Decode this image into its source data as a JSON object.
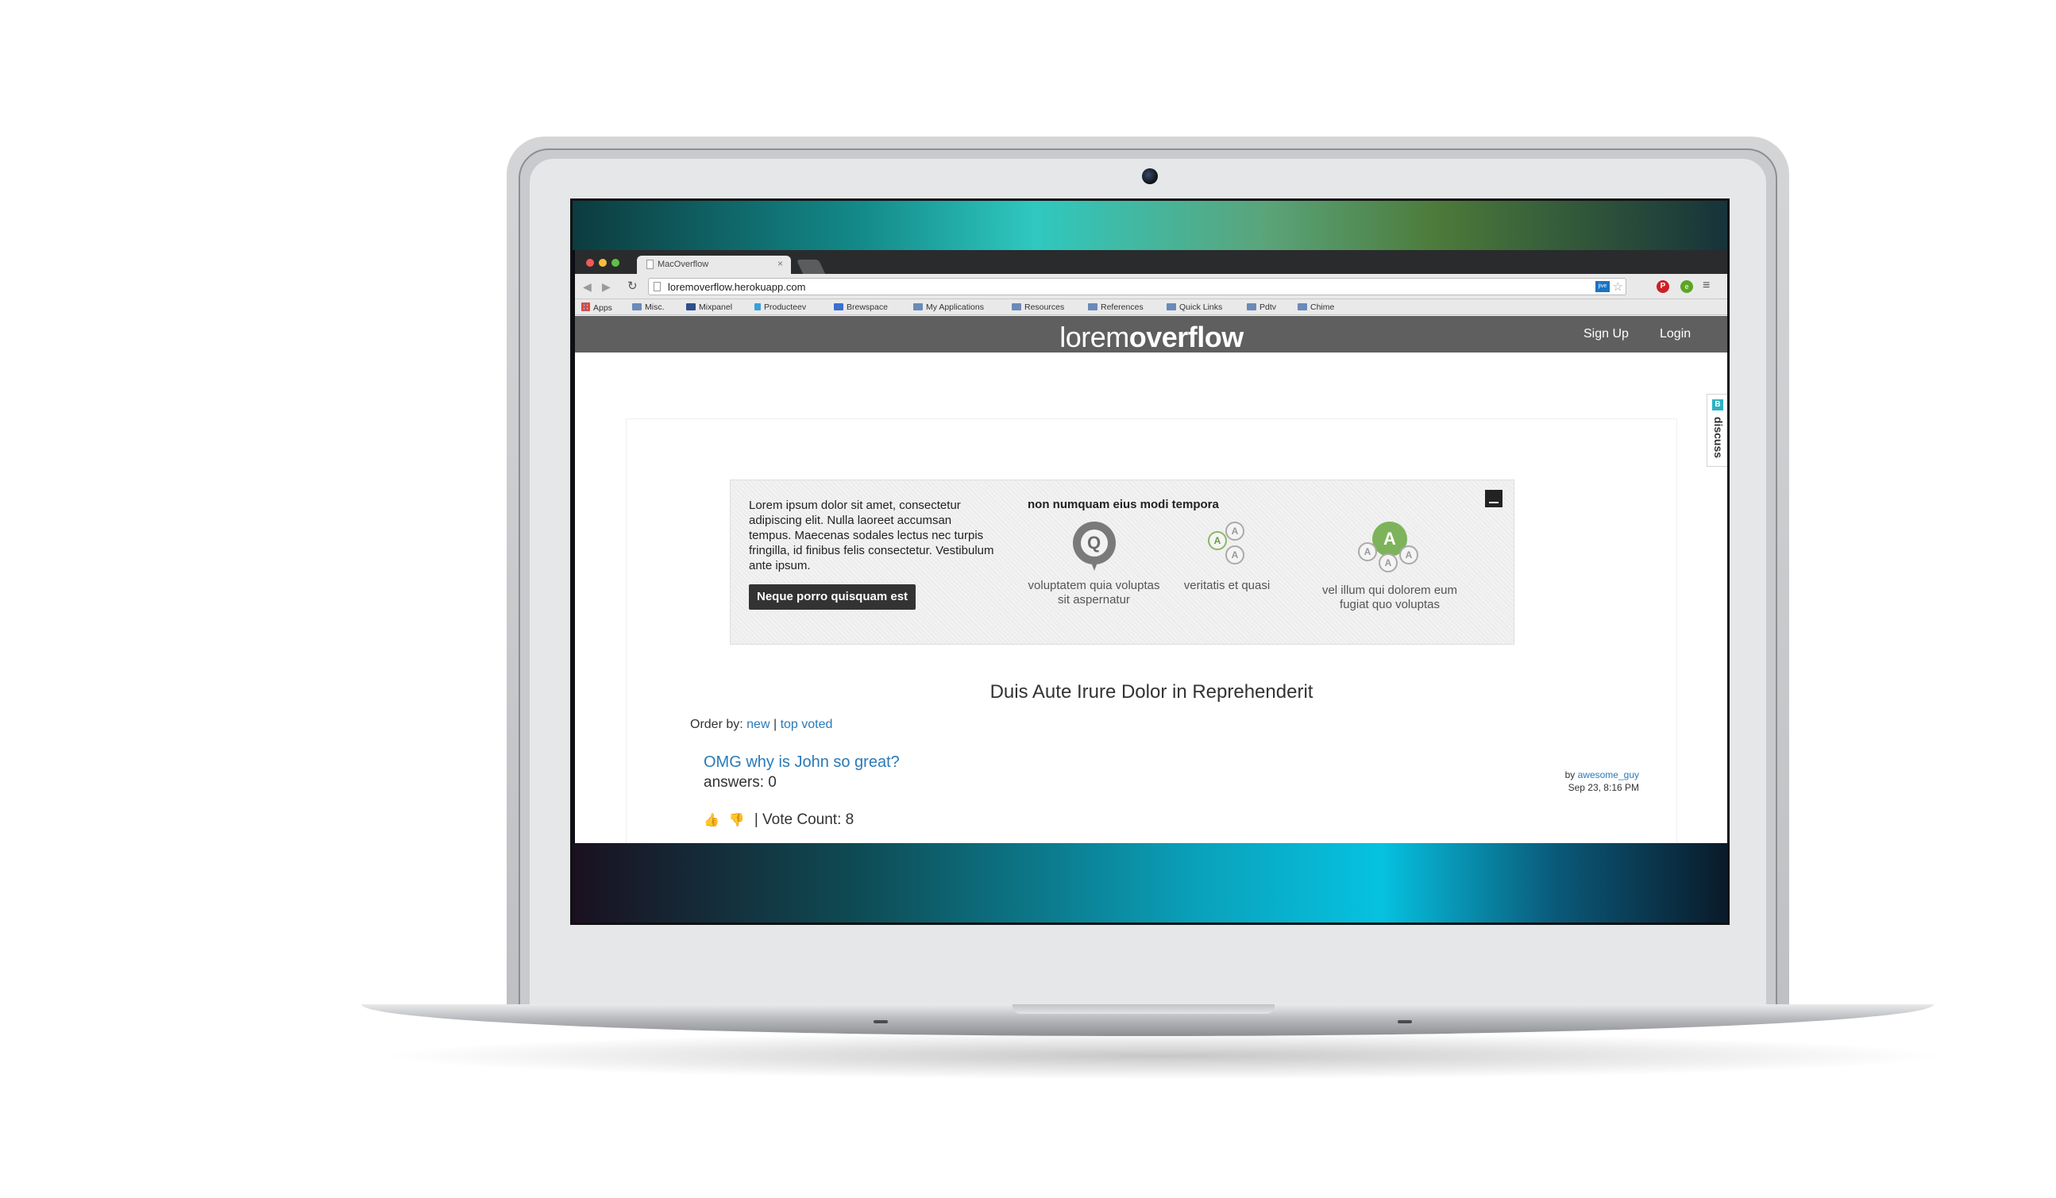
{
  "browser": {
    "tab_title": "MacOverflow",
    "url": "loremoverflow.herokuapp.com",
    "extensions": {
      "jive": "jive",
      "pinterest": "P",
      "evernote": "e"
    },
    "bookmarks": [
      "Apps",
      "Misc.",
      "Mixpanel",
      "Producteev",
      "Brewspace",
      "My Applications",
      "Resources",
      "References",
      "Quick Links",
      "Pdtv",
      "Chime"
    ]
  },
  "header": {
    "logo_light": "lorem",
    "logo_bold": "overflow",
    "signup": "Sign Up",
    "login": "Login"
  },
  "discuss": {
    "badge": "B",
    "label": "discuss"
  },
  "intro": {
    "text": "Lorem ipsum dolor sit amet, consectetur adipiscing elit. Nulla laoreet accumsan tempus. Maecenas sodales lectus nec turpis fringilla, id finibus felis consectetur. Vestibulum ante ipsum.",
    "button": "Neque porro quisquam est",
    "heading": "non numquam eius modi tempora",
    "features": [
      {
        "caption": "voluptatem quia voluptas sit aspernatur",
        "icon": "question-bubble-icon"
      },
      {
        "caption": "veritatis et quasi",
        "icon": "answers-icon"
      },
      {
        "caption": "vel illum qui dolorem eum fugiat quo voluptas",
        "icon": "accepted-answer-icon"
      }
    ],
    "icon_letters": {
      "q": "Q",
      "a": "A"
    }
  },
  "section_title": "Duis Aute Irure Dolor in Reprehenderit",
  "order_by": {
    "label": "Order by:",
    "new": "new",
    "separator": "|",
    "top_voted": "top voted"
  },
  "question": {
    "title": "OMG why is John so great?",
    "answers": "answers: 0",
    "by": "by",
    "author": "awesome_guy",
    "date": "Sep 23, 8:16 PM",
    "vote_count": "| Vote Count: 8"
  },
  "colors": {
    "header_bg": "#5f5f5f",
    "link": "#2a7ab8",
    "button_bg": "#333333",
    "accent_green": "#7db35a"
  }
}
